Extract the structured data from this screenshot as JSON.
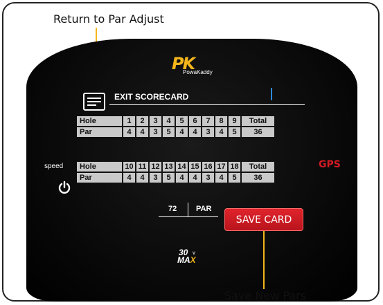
{
  "callouts": {
    "top": "Return to Par Adjust",
    "bottom": "Save New Pars"
  },
  "colors": {
    "accent_yellow": "#f3b61b",
    "gps_red": "#d11a24",
    "button_red": "#d01c24",
    "cursor_blue": "#2f89d8",
    "cell_grey": "#c9c9c9"
  },
  "logo": {
    "main": "PK",
    "subtitle": "PowaKaddy"
  },
  "scorecard": {
    "icon": "scorecard-icon",
    "exit_label": "EXIT  SCORECARD",
    "front": {
      "header_label": "Hole",
      "par_label": "Par",
      "holes": [
        "1",
        "2",
        "3",
        "4",
        "5",
        "6",
        "7",
        "8",
        "9"
      ],
      "pars": [
        "4",
        "4",
        "3",
        "5",
        "4",
        "4",
        "3",
        "4",
        "5"
      ],
      "total_label": "Total",
      "total": "36"
    },
    "back": {
      "header_label": "Hole",
      "par_label": "Par",
      "holes": [
        "10",
        "11",
        "12",
        "13",
        "14",
        "15",
        "16",
        "17",
        "18"
      ],
      "pars": [
        "4",
        "4",
        "3",
        "5",
        "4",
        "4",
        "3",
        "4",
        "5"
      ],
      "total_label": "Total",
      "total": "36"
    }
  },
  "side": {
    "speed_label": "speed",
    "power_icon": "power-icon",
    "gps_label": "GPS"
  },
  "par_total": {
    "value": "72",
    "label": "PAR"
  },
  "save_button": "SAVE CARD",
  "model_badge": {
    "number": "30",
    "unit": "v",
    "max_prefix": "MA",
    "max_suffix": "X"
  }
}
